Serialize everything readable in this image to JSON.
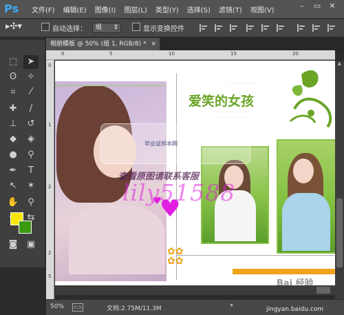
{
  "app": {
    "logo": "Ps",
    "menus": [
      "文件(F)",
      "编辑(E)",
      "图像(I)",
      "图层(L)",
      "类型(Y)",
      "选择(S)",
      "滤镜(T)",
      "视图(V)"
    ],
    "window_controls": [
      "minimize-icon",
      "restore-icon",
      "close-icon"
    ]
  },
  "options": {
    "auto_select_label": "自动选择：",
    "auto_select_value": "组",
    "show_transform_label": "显示变换控件"
  },
  "document": {
    "tab_title": "相册模板 @ 50% (组 1, RGB/8) *",
    "ruler_top": [
      "0",
      "5",
      "10",
      "15",
      "20"
    ],
    "ruler_left": [
      "0",
      "1",
      "2",
      "2",
      "5"
    ]
  },
  "canvas": {
    "title": "爱笑的女孩",
    "small_text_lines": [
      "· · · · · · · · · · ·",
      "· · · · · · · · · · · · ·",
      "· · · · · · · · · ·"
    ],
    "watermark_logo": "毕业证样本网",
    "watermark_notice": "查看原图请联系客服",
    "watermark_id": "lily51588",
    "baidu_logo": "Bai 经验",
    "baidu_url": "jingyan.baidu.com"
  },
  "colors": {
    "accent_green": "#6aa528",
    "orange_bar": "#f0a21a",
    "fg_color": "#f8e60a",
    "bg_color": "#3a9a10",
    "watermark_magenta": "#e020e0"
  },
  "status": {
    "zoom": "50%",
    "doc_info": "文档:2.75M/11.3M"
  }
}
